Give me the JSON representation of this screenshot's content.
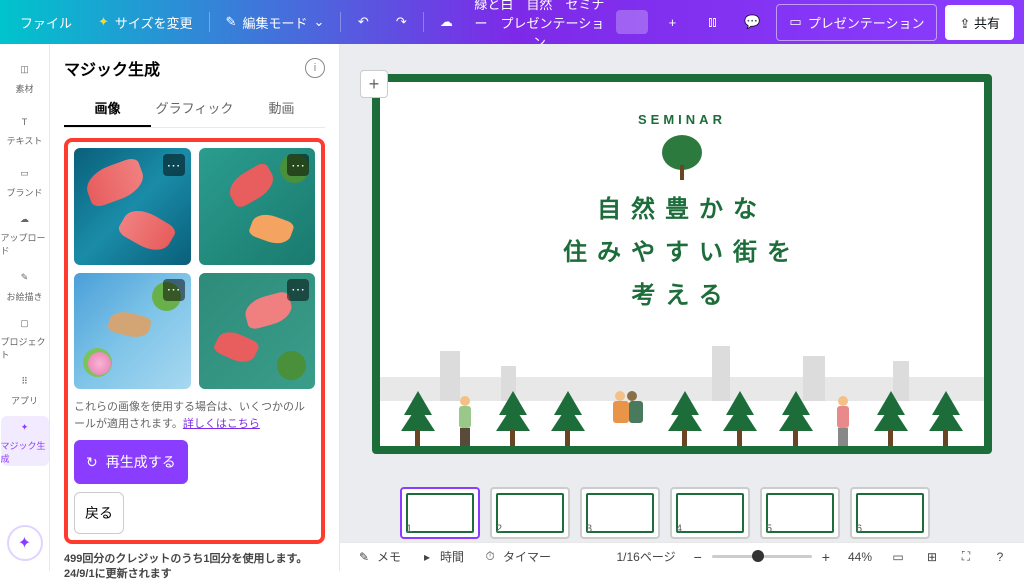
{
  "topbar": {
    "file": "ファイル",
    "resize": "サイズを変更",
    "edit_mode": "編集モード",
    "doc_title": "緑と白　自然　セミナー　プレゼンテーション",
    "present": "プレゼンテーション",
    "share": "共有"
  },
  "rail": {
    "elements": "素材",
    "text": "テキスト",
    "brand": "ブランド",
    "upload": "アップロード",
    "draw": "お絵描き",
    "project": "プロジェクト",
    "apps": "アプリ",
    "magic": "マジック生成"
  },
  "panel": {
    "title": "マジック生成",
    "tabs": {
      "image": "画像",
      "graphic": "グラフィック",
      "video": "動画"
    },
    "disclaimer": "これらの画像を使用する場合は、いくつかのルールが適用されます。",
    "disclaimer_link": "詳しくはこちら",
    "regenerate": "再生成する",
    "back": "戻る",
    "credit": "499回分のクレジットのうち1回分を使用します。24/9/1に更新されます"
  },
  "slide": {
    "seminar": "SEMINAR",
    "line1": "自然豊かな",
    "line2": "住みやすい街を",
    "line3": "考える"
  },
  "thumbs": {
    "t1": "1",
    "t2": "2",
    "t3": "3",
    "t4": "4",
    "t5": "5",
    "t6": "6"
  },
  "bottombar": {
    "notes": "メモ",
    "duration": "時間",
    "timer": "タイマー",
    "page": "1/16ページ",
    "zoom": "44%"
  }
}
